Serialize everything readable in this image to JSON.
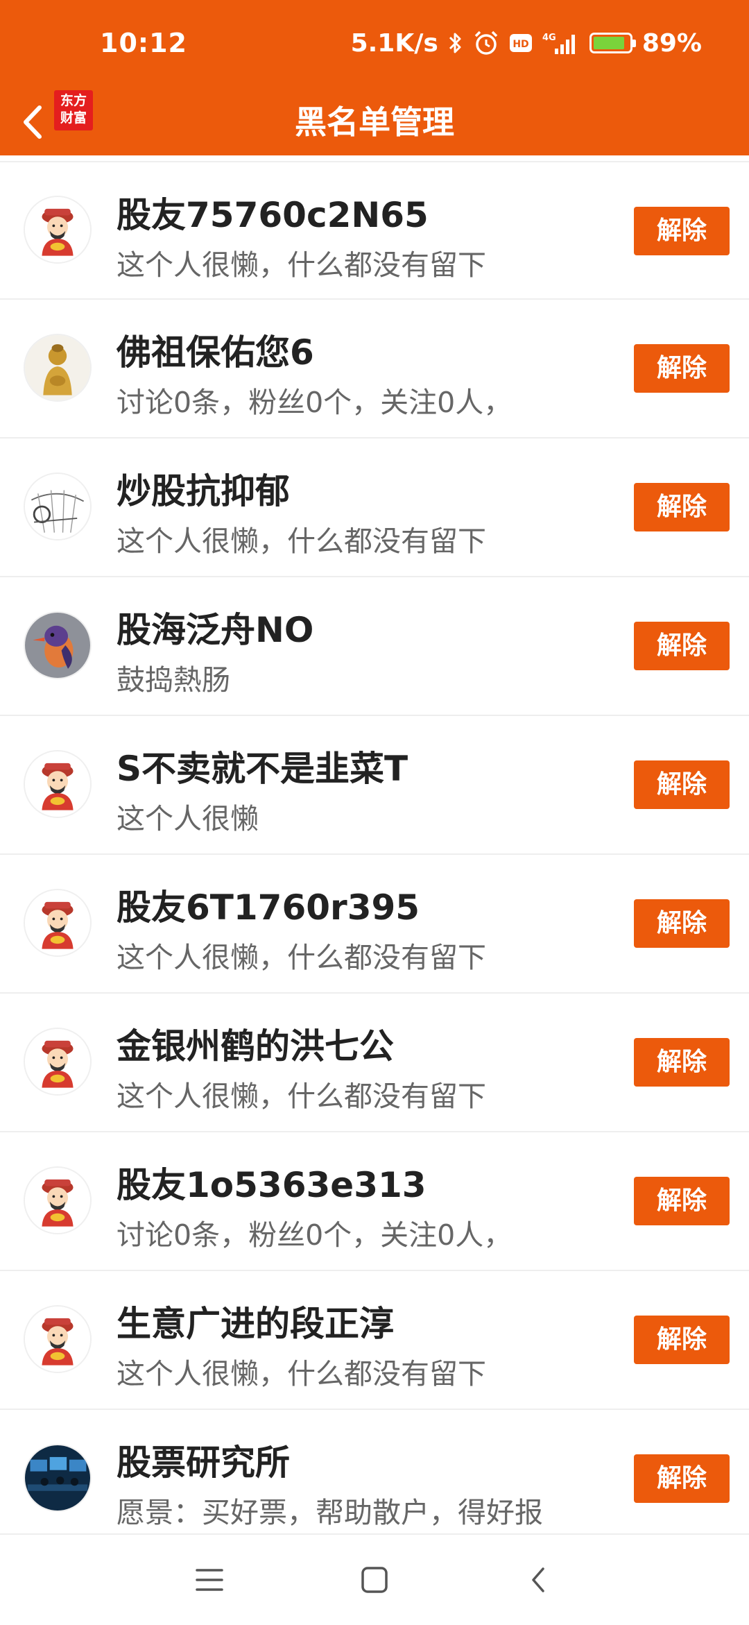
{
  "status_bar": {
    "time": "10:12",
    "network_speed": "5.1K/s",
    "icons": [
      "bluetooth-icon",
      "alarm-icon",
      "hd-icon",
      "4g-signal-icon"
    ],
    "battery_percent": "89%",
    "battery_level": 0.89
  },
  "nav": {
    "title": "黑名单管理",
    "logo_line1": "东方",
    "logo_line2": "财富"
  },
  "blocked_users": [
    {
      "name": "股友75760c2N65",
      "desc": "这个人很懒，什么都没有留下",
      "avatar": "caishen-avatar",
      "action": "解除"
    },
    {
      "name": "佛祖保佑您6",
      "desc": "讨论0条，粉丝0个，关注0人，",
      "avatar": "buddha-avatar",
      "action": "解除"
    },
    {
      "name": "炒股抗抑郁",
      "desc": "这个人很懒，什么都没有留下",
      "avatar": "sketch-avatar",
      "action": "解除"
    },
    {
      "name": "股海泛舟NO",
      "desc": "鼓捣熱肠",
      "avatar": "bird-avatar",
      "action": "解除"
    },
    {
      "name": "S不卖就不是韭菜T",
      "desc": "这个人很懒",
      "avatar": "caishen-avatar",
      "action": "解除"
    },
    {
      "name": "股友6T1760r395",
      "desc": "这个人很懒，什么都没有留下",
      "avatar": "caishen-avatar",
      "action": "解除"
    },
    {
      "name": "金银州鹤的洪七公",
      "desc": "这个人很懒，什么都没有留下",
      "avatar": "caishen-avatar",
      "action": "解除"
    },
    {
      "name": "股友1o5363e313",
      "desc": "讨论0条，粉丝0个，关注0人，",
      "avatar": "caishen-avatar",
      "action": "解除"
    },
    {
      "name": "生意广进的段正淳",
      "desc": "这个人很懒，什么都没有留下",
      "avatar": "caishen-avatar",
      "action": "解除"
    },
    {
      "name": "股票研究所",
      "desc": "愿景：买好票，帮助散户，得好报",
      "avatar": "trading-room-avatar",
      "action": "解除"
    }
  ],
  "system_nav": {
    "icons": [
      "menu-icon",
      "home-icon",
      "back-icon"
    ]
  },
  "colors": {
    "brand": "#EC5A0C",
    "logo_red": "#E41E1E",
    "name_text": "#222222",
    "desc_text": "#666666",
    "divider": "#EEEEEE"
  }
}
